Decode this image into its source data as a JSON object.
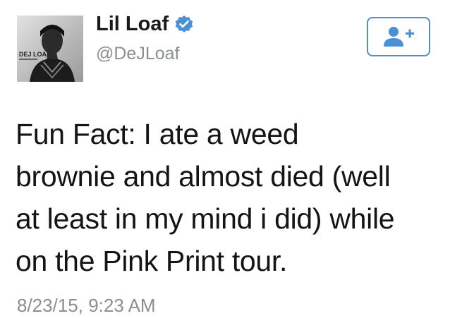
{
  "tweet": {
    "avatar_caption": "DEJ LOAF",
    "display_name": "Lil Loaf",
    "handle": "@DeJLoaf",
    "text_lines": [
      "Fun Fact: I ate a weed",
      "brownie and almost died (well",
      "at least in my mind i did) while",
      "on the Pink Print tour."
    ],
    "timestamp": "8/23/15, 9:23 AM",
    "follow_icon": "add-user-icon",
    "verified_icon": "verified-badge-icon"
  },
  "colors": {
    "accent": "#4a90d6",
    "name_text": "#1a1a1a",
    "muted_text": "#8a8f94",
    "body_text": "#141414"
  }
}
